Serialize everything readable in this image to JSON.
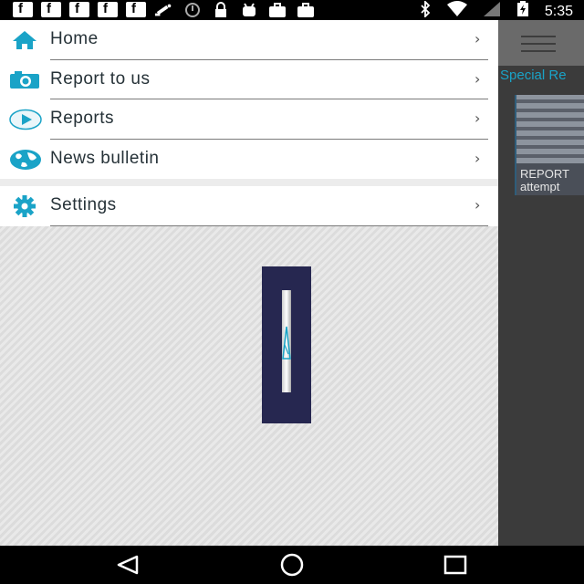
{
  "status_bar": {
    "time": "5:35",
    "left_icons": [
      "facebook-icon",
      "facebook-icon",
      "facebook-icon",
      "facebook-icon",
      "facebook-icon",
      "satellite-icon",
      "circle-icon",
      "lock-icon",
      "android-icon",
      "briefcase-icon",
      "briefcase-icon"
    ],
    "right_icons": [
      "bluetooth-icon",
      "wifi-icon",
      "signal-icon",
      "battery-icon"
    ]
  },
  "drawer": {
    "items": [
      {
        "label": "Home",
        "icon": "home-icon"
      },
      {
        "label": "Report to us",
        "icon": "camera-icon"
      },
      {
        "label": "Reports",
        "icon": "play-icon"
      },
      {
        "label": "News bulletin",
        "icon": "globe-icon"
      }
    ],
    "settings": {
      "label": "Settings",
      "icon": "gear-icon"
    },
    "chevron": "›"
  },
  "background_app": {
    "section_title": "Special Re",
    "thumb_line1": "REPORT",
    "thumb_line2": "attempt"
  },
  "colors": {
    "accent": "#1aa3c7",
    "logo_bg": "#262750",
    "drawer_text": "#263238"
  }
}
